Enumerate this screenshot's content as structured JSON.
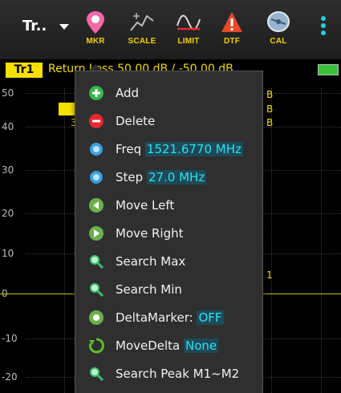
{
  "toolbar": {
    "trace_label": "Tr..",
    "buttons": [
      {
        "label": "MKR",
        "icon": "marker-pin-icon"
      },
      {
        "label": "SCALE",
        "icon": "scale-icon"
      },
      {
        "label": "LIMIT",
        "icon": "limit-icon"
      },
      {
        "label": "DTF",
        "icon": "dtf-warning-icon"
      },
      {
        "label": "CAL",
        "icon": "cal-dish-icon"
      }
    ]
  },
  "trace": {
    "badge": "Tr1",
    "info": "Return Loss 50.00 dB / -50.00 dB"
  },
  "plot": {
    "y_labels": [
      "50",
      "40",
      "30",
      "20",
      "10",
      "0",
      "-10",
      "-20"
    ],
    "marker_fragments": [
      "B",
      "B",
      "B",
      "3",
      "1"
    ]
  },
  "menu": {
    "items": [
      {
        "label": "Add",
        "value": "",
        "icon": "add-icon",
        "color": "#37b34a"
      },
      {
        "label": "Delete",
        "value": "",
        "icon": "delete-icon",
        "color": "#e8262e"
      },
      {
        "label": "Freq",
        "value": "1521.6770 MHz",
        "icon": "freq-icon",
        "color": "#3aa0e0"
      },
      {
        "label": "Step",
        "value": "27.0 MHz",
        "icon": "step-icon",
        "color": "#3aa0e0"
      },
      {
        "label": "Move Left",
        "value": "",
        "icon": "move-left-icon",
        "color": "#6ab04c"
      },
      {
        "label": "Move Right",
        "value": "",
        "icon": "move-right-icon",
        "color": "#6ab04c"
      },
      {
        "label": "Search Max",
        "value": "",
        "icon": "search-max-icon",
        "color": "#3bbf6e"
      },
      {
        "label": "Search Min",
        "value": "",
        "icon": "search-min-icon",
        "color": "#3bbf6e"
      },
      {
        "label": "DeltaMarker:",
        "value": "OFF",
        "icon": "delta-marker-icon",
        "color": "#6ab04c"
      },
      {
        "label": "MoveDelta",
        "value": "None",
        "icon": "move-delta-icon",
        "color": "#5bbf2a"
      },
      {
        "label": "Search Peak M1~M2",
        "value": "",
        "icon": "search-peak-icon",
        "color": "#3bbf6e"
      }
    ]
  }
}
